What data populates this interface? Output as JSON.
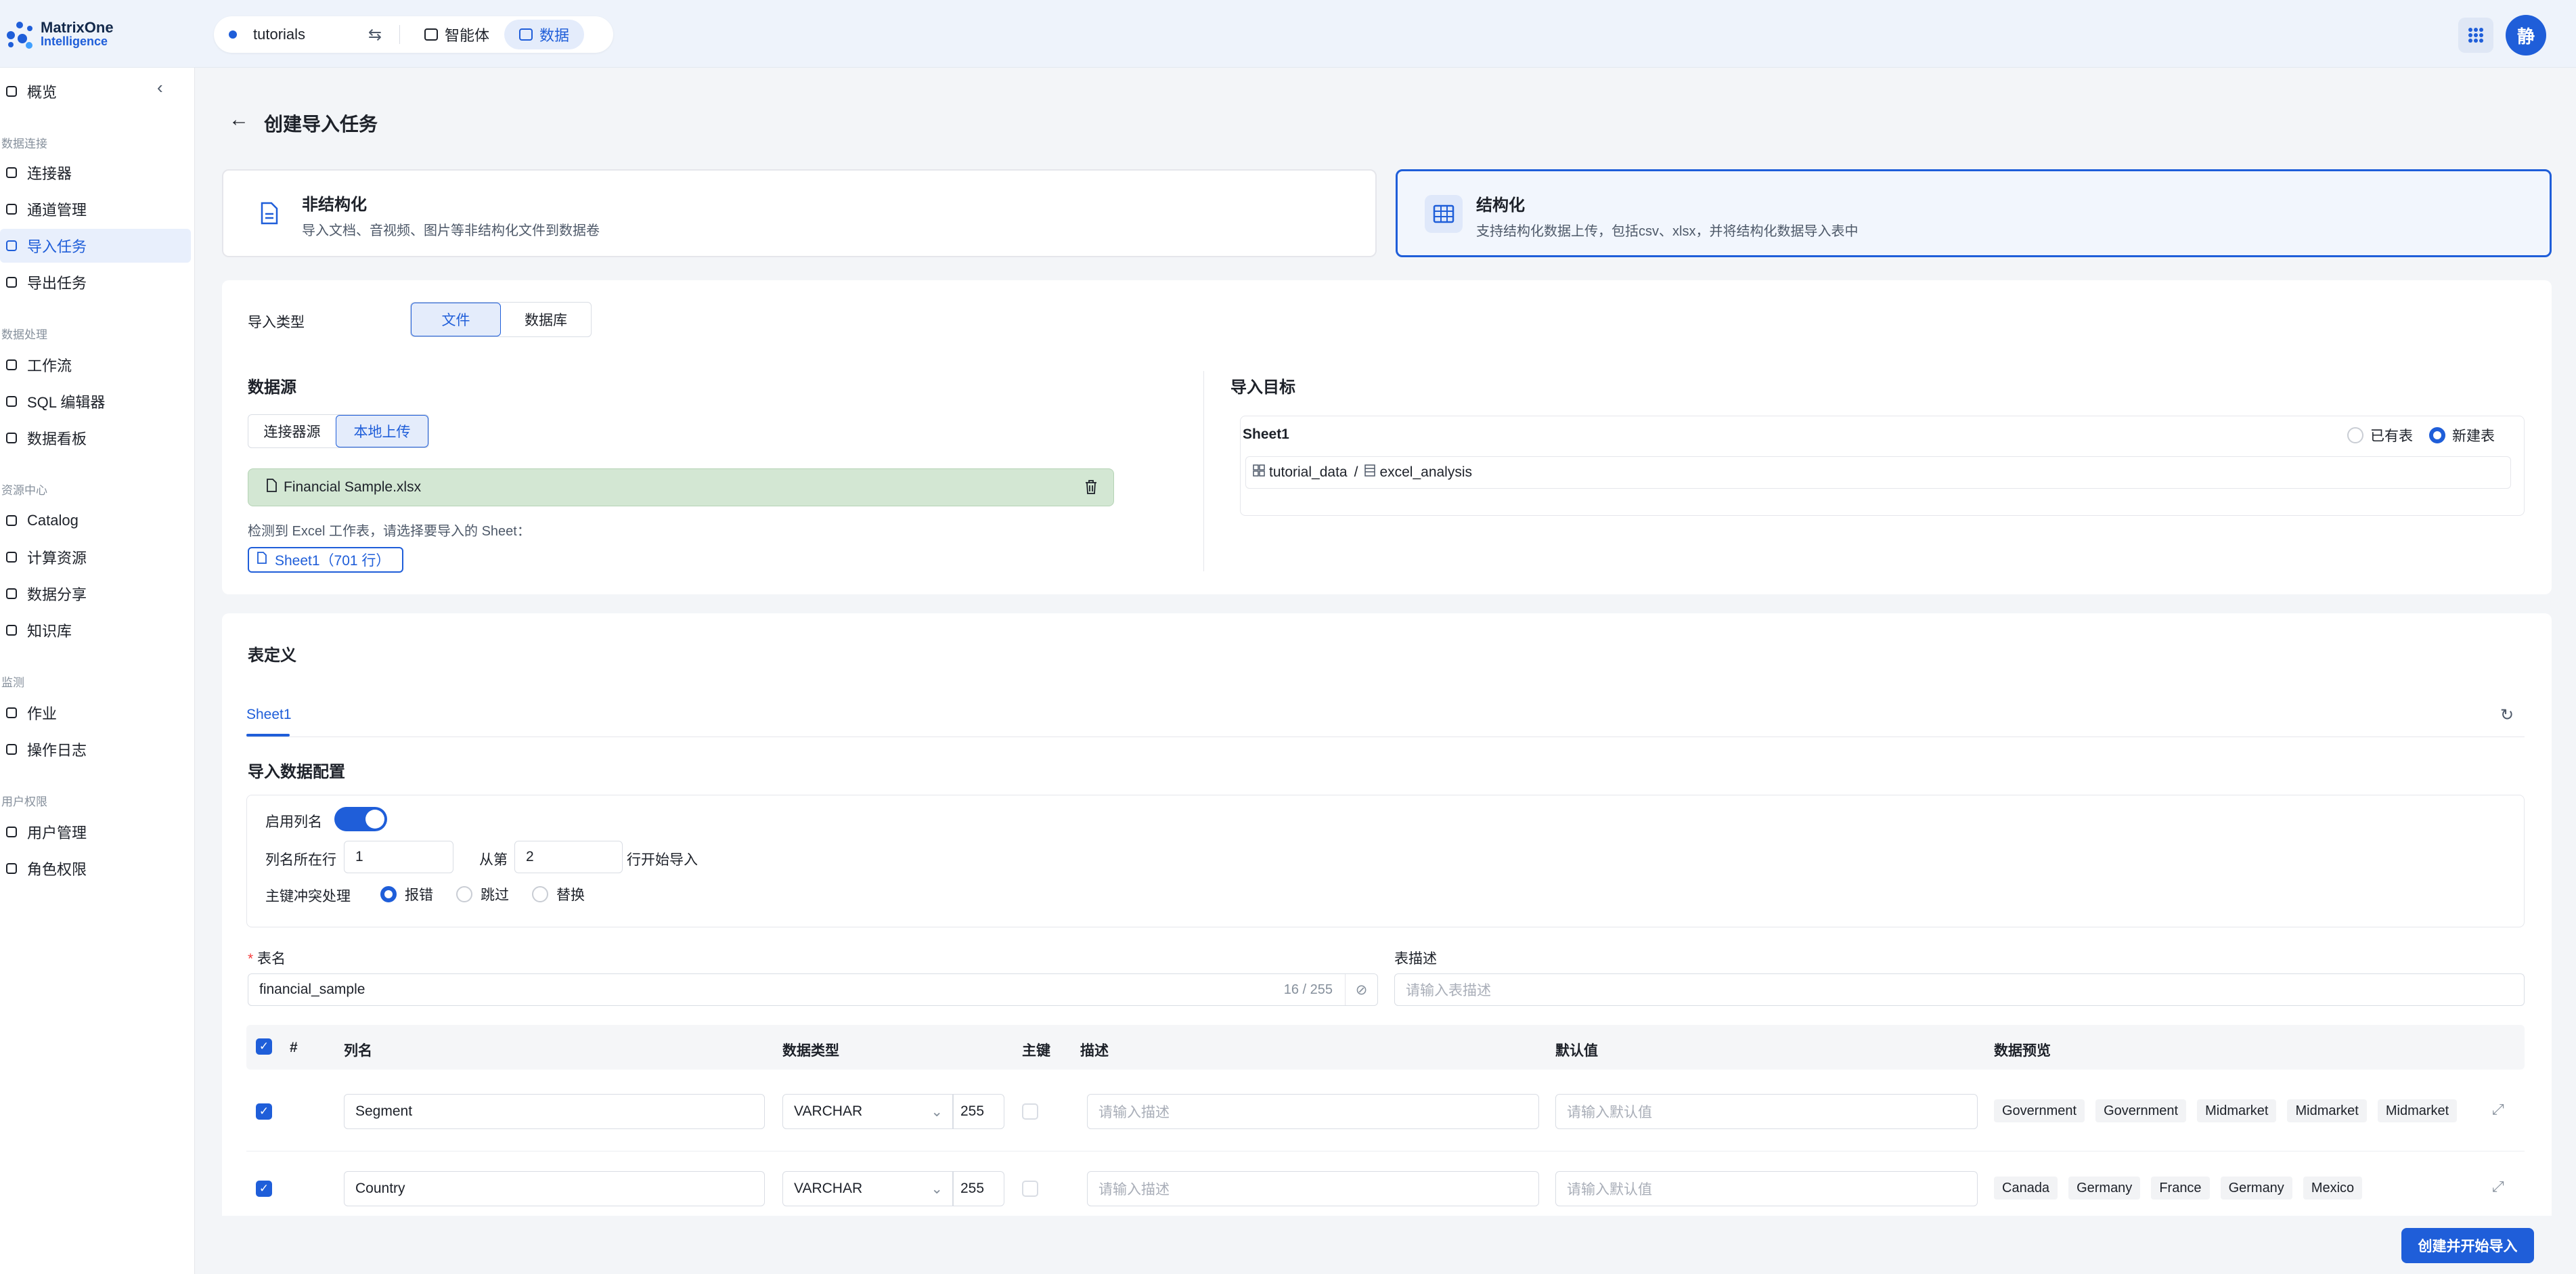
{
  "brand": {
    "line1": "MatrixOne",
    "line2": "Intelligence",
    "color": "#1f5ed9"
  },
  "header": {
    "workspace": "tutorials",
    "tabs": [
      {
        "label": "智能体",
        "icon": "robot-icon"
      },
      {
        "label": "数据",
        "icon": "database-icon",
        "active": true
      }
    ],
    "avatar": "静"
  },
  "sidebar": {
    "top": {
      "label": "概览",
      "icon": "home-icon"
    },
    "sections": [
      {
        "title": "数据连接",
        "items": [
          {
            "label": "连接器",
            "icon": "link-icon"
          },
          {
            "label": "通道管理",
            "icon": "channel-icon"
          },
          {
            "label": "导入任务",
            "icon": "import-icon",
            "active": true
          },
          {
            "label": "导出任务",
            "icon": "export-icon"
          }
        ]
      },
      {
        "title": "数据处理",
        "items": [
          {
            "label": "工作流",
            "icon": "workflow-icon"
          },
          {
            "label": "SQL 编辑器",
            "icon": "sql-icon"
          },
          {
            "label": "数据看板",
            "icon": "dashboard-icon"
          }
        ]
      },
      {
        "title": "资源中心",
        "items": [
          {
            "label": "Catalog",
            "icon": "book-icon"
          },
          {
            "label": "计算资源",
            "icon": "cloud-icon"
          },
          {
            "label": "数据分享",
            "icon": "share-icon"
          },
          {
            "label": "知识库",
            "icon": "bulb-icon"
          }
        ]
      },
      {
        "title": "监测",
        "items": [
          {
            "label": "作业",
            "icon": "list-icon"
          },
          {
            "label": "操作日志",
            "icon": "log-icon"
          }
        ]
      },
      {
        "title": "用户权限",
        "items": [
          {
            "label": "用户管理",
            "icon": "user-icon"
          },
          {
            "label": "角色权限",
            "icon": "shield-icon"
          }
        ]
      }
    ]
  },
  "page": {
    "title": "创建导入任务"
  },
  "modes": [
    {
      "title": "非结构化",
      "desc": "导入文档、音视频、图片等非结构化文件到数据卷",
      "icon": "document-icon"
    },
    {
      "title": "结构化",
      "desc": "支持结构化数据上传，包括csv、xlsx，并将结构化数据导入表中",
      "icon": "table-icon",
      "selected": true
    }
  ],
  "import_type": {
    "label": "导入类型",
    "options": [
      "文件",
      "数据库"
    ],
    "selected": "文件"
  },
  "source": {
    "title": "数据源",
    "options": [
      "连接器源",
      "本地上传"
    ],
    "selected": "本地上传",
    "file_name": "Financial Sample.xlsx",
    "hint": "检测到 Excel 工作表，请选择要导入的 Sheet：",
    "sheet_chip": "Sheet1（701 行）"
  },
  "target": {
    "title": "导入目标",
    "sheet": "Sheet1",
    "opt_existing": "已有表",
    "opt_new": "新建表",
    "selected": "新建表",
    "database": "tutorial_data",
    "separator": "/",
    "table": "excel_analysis"
  },
  "table_def": {
    "title": "表定义",
    "tab": "Sheet1",
    "config_title": "导入数据配置",
    "enable_header_label": "启用列名",
    "enable_header": true,
    "header_row_label": "列名所在行",
    "header_row": "1",
    "from_label": "从第",
    "start_row": "2",
    "start_suffix": "行开始导入",
    "conflict_label": "主键冲突处理",
    "conflict_options": [
      "报错",
      "跳过",
      "替换"
    ],
    "conflict_selected": "报错",
    "name_label": "表名",
    "name_required": "*",
    "name_value": "financial_sample",
    "name_count": "16 / 255",
    "desc_label": "表描述",
    "desc_placeholder": "请输入表描述"
  },
  "columns_table": {
    "headers": [
      "#",
      "列名",
      "数据类型",
      "主键",
      "描述",
      "默认值",
      "数据预览"
    ],
    "desc_placeholder": "请输入描述",
    "default_placeholder": "请输入默认值",
    "rows": [
      {
        "name": "Segment",
        "type": "VARCHAR",
        "length": "255",
        "preview": [
          "Government",
          "Government",
          "Midmarket",
          "Midmarket",
          "Midmarket"
        ]
      },
      {
        "name": "Country",
        "type": "VARCHAR",
        "length": "255",
        "preview": [
          "Canada",
          "Germany",
          "France",
          "Germany",
          "Mexico"
        ]
      }
    ]
  },
  "actions": {
    "submit": "创建并开始导入"
  }
}
